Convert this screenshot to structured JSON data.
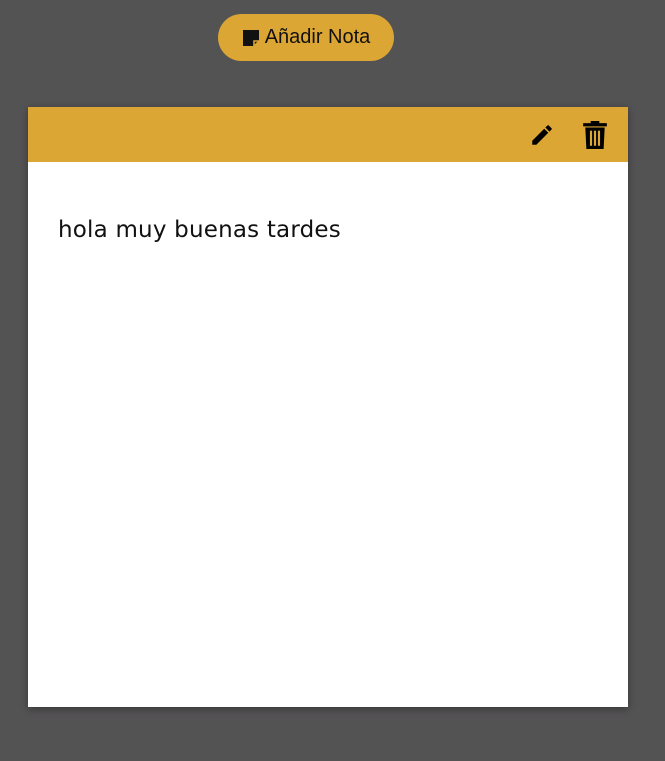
{
  "toolbar": {
    "add_note_label": "Añadir Nota",
    "add_note_icon": "sticky-note-icon",
    "accent_color": "#dca635"
  },
  "note": {
    "text": "hola muy buenas tardes",
    "header_color": "#dca635",
    "actions": {
      "edit_icon": "pencil-icon",
      "delete_icon": "trash-icon"
    }
  },
  "page": {
    "background_color": "#545354"
  }
}
